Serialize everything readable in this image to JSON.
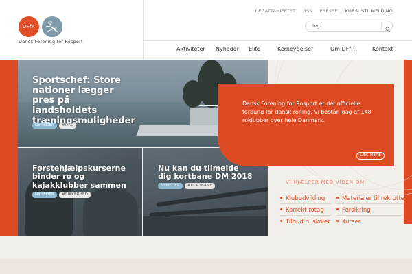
{
  "header": {
    "logo": {
      "circle_text": "DFfR",
      "name": "Dansk Forening for Rosport",
      "icon": "rower-icon"
    },
    "utility_links": [
      "REGATTAHÆFTET",
      "RSS",
      "PRESSE",
      "KURSUSTILMELDING"
    ],
    "search": {
      "placeholder": "Søg..."
    },
    "nav": [
      "Aktiviteter",
      "Nyheder",
      "Elite",
      "Kerneydelser",
      "Om DFfR",
      "Kontakt"
    ]
  },
  "tiles": [
    {
      "title_lines": [
        "Sportschef: Store",
        "nationer lægger",
        "pres på",
        "landsholdets",
        "træningsmuligheder"
      ],
      "tags": [
        "NYHEDER",
        "#DRC"
      ]
    },
    {
      "title_lines": [
        "Førstehjælpskurserne",
        "binder ro og",
        "kajakklubber sammen"
      ],
      "tags": [
        "NYHEDER",
        "#SIKKERHED"
      ]
    },
    {
      "title_lines": [
        "Nu kan du tilmelde",
        "dig kortbane DM 2018"
      ],
      "tags": [
        "NYHEDER",
        "#KORTBANE"
      ]
    }
  ],
  "callout": {
    "text": "Dansk Forening for Rosport er det officielle forbund for dansk roning. Vi består idag af 148 roklubber over hele Danmark.",
    "button": "LÆS MERE"
  },
  "help": {
    "title": "VI HJÆLPER MED VIDEN OM",
    "links_left": [
      "Klubudvikling",
      "Korrekt rotag",
      "Tilbud til skoler"
    ],
    "links_right": [
      "Materialer til rekruttering",
      "Forsikring",
      "Kurser"
    ]
  },
  "colors": {
    "brand_orange": "#dd4b24",
    "logo_blue": "#7f9aa8",
    "tag_blue": "#8dbad3"
  }
}
